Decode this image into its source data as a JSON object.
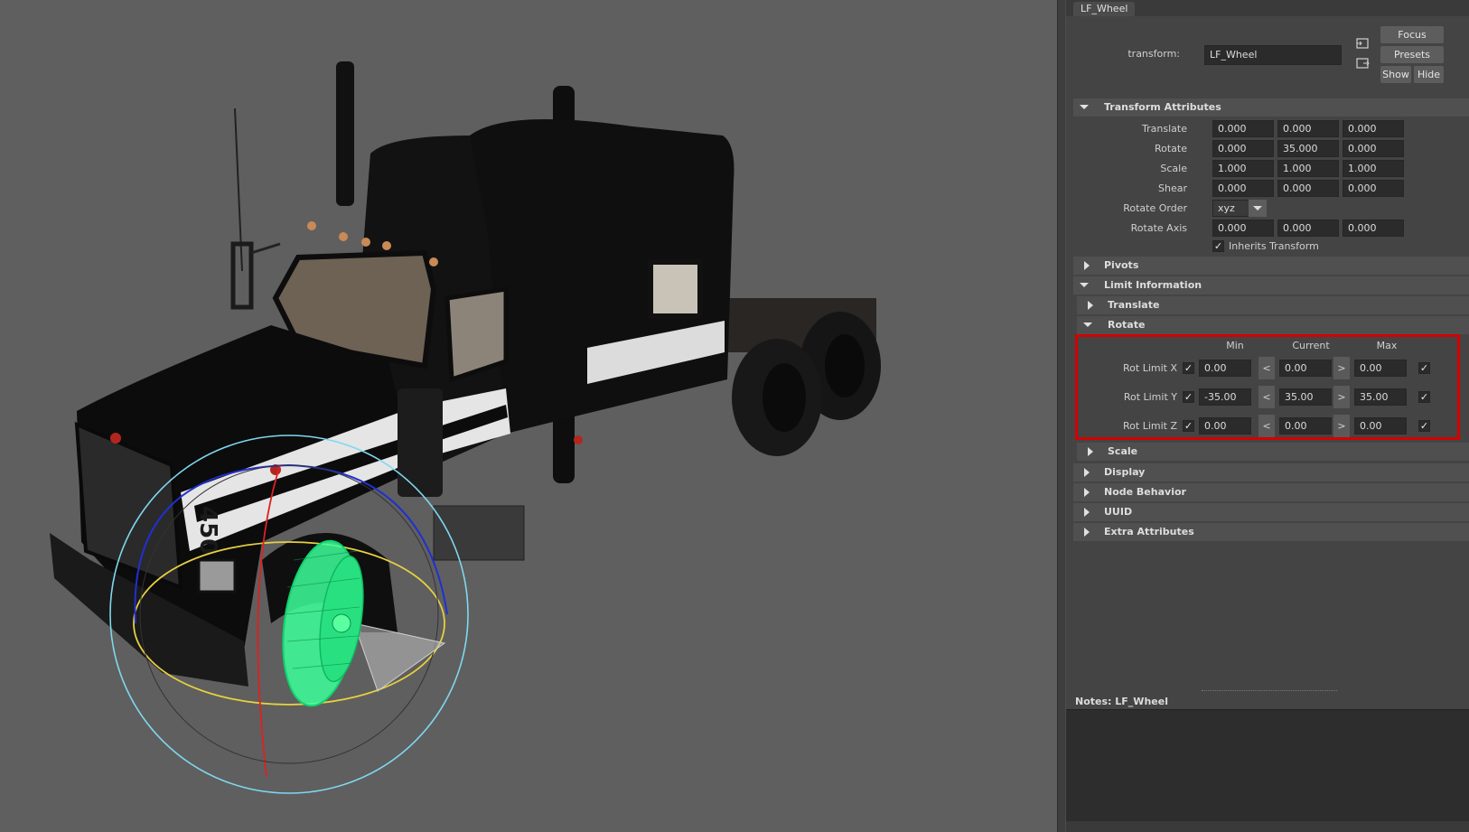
{
  "tab": {
    "label": "LF_Wheel"
  },
  "node": {
    "type_label": "transform:",
    "name_value": "LF_Wheel"
  },
  "buttons": {
    "focus": "Focus",
    "presets": "Presets",
    "show": "Show",
    "hide": "Hide"
  },
  "transform_attributes": {
    "header": "Transform Attributes",
    "rows": [
      {
        "label": "Translate",
        "values": [
          "0.000",
          "0.000",
          "0.000"
        ]
      },
      {
        "label": "Rotate",
        "values": [
          "0.000",
          "35.000",
          "0.000"
        ]
      },
      {
        "label": "Scale",
        "values": [
          "1.000",
          "1.000",
          "1.000"
        ]
      },
      {
        "label": "Shear",
        "values": [
          "0.000",
          "0.000",
          "0.000"
        ]
      }
    ],
    "rotate_order_label": "Rotate Order",
    "rotate_order_value": "xyz",
    "rotate_axis_label": "Rotate Axis",
    "rotate_axis_values": [
      "0.000",
      "0.000",
      "0.000"
    ],
    "inherits_label": "Inherits Transform",
    "inherits_checked": "✓"
  },
  "sections": {
    "pivots": "Pivots",
    "limit_information": "Limit Information",
    "translate": "Translate",
    "rotate": "Rotate",
    "scale": "Scale",
    "display": "Display",
    "node_behavior": "Node Behavior",
    "uuid": "UUID",
    "extra_attributes": "Extra Attributes"
  },
  "rotate_limits": {
    "col_min": "Min",
    "col_current": "Current",
    "col_max": "Max",
    "less_than": "<",
    "greater_than": ">",
    "check": "✓",
    "rows": [
      {
        "label": "Rot Limit X",
        "min": "0.00",
        "current": "0.00",
        "max": "0.00"
      },
      {
        "label": "Rot Limit Y",
        "min": "-35.00",
        "current": "35.00",
        "max": "35.00"
      },
      {
        "label": "Rot Limit Z",
        "min": "0.00",
        "current": "0.00",
        "max": "0.00"
      }
    ]
  },
  "notes": {
    "label": "Notes:",
    "node": "LF_Wheel"
  },
  "truck": {
    "number": "450"
  },
  "colors": {
    "viewport_bg": "#5f5f5f",
    "panel_bg": "#444444",
    "highlight": "#d40000",
    "selection": "#3cff9a",
    "gizmo_cyan": "#7fd8f0",
    "gizmo_red": "#e02020",
    "gizmo_blue": "#2030d0",
    "gizmo_yellow": "#e8d040"
  }
}
